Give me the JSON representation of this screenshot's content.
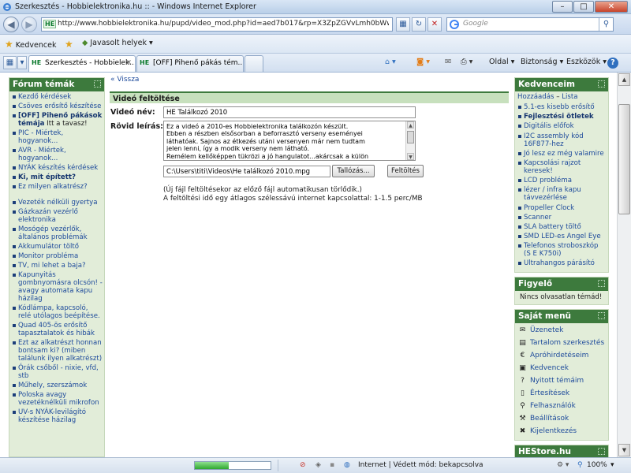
{
  "window": {
    "title": "Szerkesztés - Hobbielektronika.hu :: - Windows Internet Explorer",
    "minimize": "–",
    "maximize": "□",
    "close": "✕"
  },
  "address": {
    "site_badge": "HE",
    "url": "http://www.hobbielektronika.hu/pupd/video_mod.php?id=aed7b017&rp=X3ZpZGVvLmh0bWw=",
    "search_placeholder": "Google"
  },
  "favorites": {
    "favorites_label": "Kedvencek",
    "suggested_label": "Javasolt helyek ▾"
  },
  "tabs": [
    {
      "badge": "HE",
      "label": "Szerkesztés - Hobbielek...",
      "close": "✕"
    },
    {
      "badge": "HE",
      "label": "[OFF] Pihenő pákás tém..."
    }
  ],
  "toolbar": {
    "page": "Oldal ▾",
    "safety": "Biztonság ▾",
    "tools": "Eszközök ▾",
    "help": "?"
  },
  "left_sidebar": {
    "title": "Fórum témák",
    "groups": [
      [
        {
          "text": "Kezdő kérdések"
        },
        {
          "text": "Csöves erősítő készítése"
        },
        {
          "text": "[OFF] Pihenő pákások témája",
          "suffix": " Itt a tavasz!",
          "bold": true
        },
        {
          "text": "PIC - Miértek, hogyanok..."
        },
        {
          "text": "AVR - Miértek, hogyanok..."
        },
        {
          "text": "NYÁK készítés kérdések"
        },
        {
          "text": "Ki, mit épített?",
          "bold": true
        },
        {
          "text": "Ez milyen alkatrész?"
        }
      ],
      [
        {
          "text": "Vezeték nélküli gyertya"
        },
        {
          "text": "Gázkazán vezérlő elektronika"
        },
        {
          "text": "Mosógép vezérlők, általános problémák"
        },
        {
          "text": "Akkumulátor töltő"
        },
        {
          "text": "Monitor probléma"
        },
        {
          "text": "TV, mi lehet a baja?"
        },
        {
          "text": "Kapunyitás gombnyomásra olcsón! - avagy automata kapu házilag"
        },
        {
          "text": "Kódlámpa, kapcsoló, relé utólagos beépítése."
        },
        {
          "text": "Quad 405-ös erősítő tapasztalatok és hibák"
        },
        {
          "text": "Ezt az alkatrészt honnan bontsam ki? (miben találunk ilyen alkatrészt)"
        },
        {
          "text": "Órák csőből - nixie, vfd, stb"
        },
        {
          "text": "Műhely, szerszámok"
        },
        {
          "text": "Poloska avagy vezetéknélküli mikrofon"
        },
        {
          "text": "UV-s NYÁK-levilágító készítése házilag"
        }
      ]
    ]
  },
  "main": {
    "back_link": "« Vissza",
    "form_title": "Videó feltöltése",
    "name_label": "Videó név:",
    "name_value": "HE Találkozó 2010",
    "desc_label": "Rövid leírás:",
    "desc_lines": [
      "Ez a videó a 2010-es Hobbielektronika találkozón készült.",
      "Ebben a részben elsősorban a beforrasztó verseny eseményei",
      "láthatóak. Sajnos az étkezés utáni versenyen már nem tudtam",
      "jelen lenni, így a modik verseny nem látható.",
      "Remélem kellőképpen tükrözi a jó hangulatot...akárcsak a külön"
    ],
    "file_value": "C:\\Users\\titi\\Videos\\He találkozó 2010.mpg",
    "browse_button": "Tallózás...",
    "upload_button": "Feltöltés",
    "note_1": "(Új fájl feltöltésekor az előző fájl automatikusan törlődik.)",
    "note_2": "A feltöltési idő egy átlagos szélessávú internet kapcsolattal: 1-1.5 perc/MB"
  },
  "right_sidebar": {
    "favorites_title": "Kedvenceim",
    "favorites_add": "Hozzáadás",
    "favorites_sep": " – ",
    "favorites_list": "Lista",
    "favorites_items": [
      {
        "text": "5.1-es kisebb erősítő"
      },
      {
        "text": "Fejlesztési ötletek",
        "bold": true
      },
      {
        "text": "Digitális előfok"
      },
      {
        "text": "I2C assembly kód 16F877-hez"
      },
      {
        "text": "Jó lesz ez még valamire"
      },
      {
        "text": "Kapcsolási rajzot keresek!"
      },
      {
        "text": "LCD probléma"
      },
      {
        "text": "lézer / infra kapu távvezérlése"
      },
      {
        "text": "Propeller Clock"
      },
      {
        "text": "Scanner"
      },
      {
        "text": "SLA battery töltő"
      },
      {
        "text": "SMD LED-es Angel Eye"
      },
      {
        "text": "Telefonos stroboszkóp (S E K750i)"
      },
      {
        "text": "Ultrahangos párásító"
      }
    ],
    "watch_title": "Figyelő",
    "watch_text": "Nincs olvasatlan témád!",
    "menu_title": "Saját menü",
    "menu_items": [
      {
        "label": "Üzenetek",
        "icon": "envelope-icon",
        "glyph": "✉"
      },
      {
        "label": "Tartalom szerkesztés",
        "icon": "document-icon",
        "glyph": "▤"
      },
      {
        "label": "Apróhirdetéseim",
        "icon": "ads-icon",
        "glyph": "€"
      },
      {
        "label": "Kedvencek",
        "icon": "favorites-icon",
        "glyph": "▣"
      },
      {
        "label": "Nyitott témáim",
        "icon": "question-icon",
        "glyph": "?"
      },
      {
        "label": "Értesítések",
        "icon": "notification-icon",
        "glyph": "▯"
      },
      {
        "label": "Felhasználók",
        "icon": "users-icon",
        "glyph": "⚲"
      },
      {
        "label": "Beállítások",
        "icon": "tools-icon",
        "glyph": "⚒"
      },
      {
        "label": "Kijelentkezés",
        "icon": "logout-icon",
        "glyph": "✖"
      }
    ],
    "store_title": "HEStore.hu"
  },
  "statusbar": {
    "zone": "Internet | Védett mód: bekapcsolva",
    "zoom": "100%",
    "progress": 0.45
  },
  "colors": {
    "box_header": "#3d7a3d",
    "box_bg": "#e2edd9",
    "link": "#1d4a9b"
  }
}
